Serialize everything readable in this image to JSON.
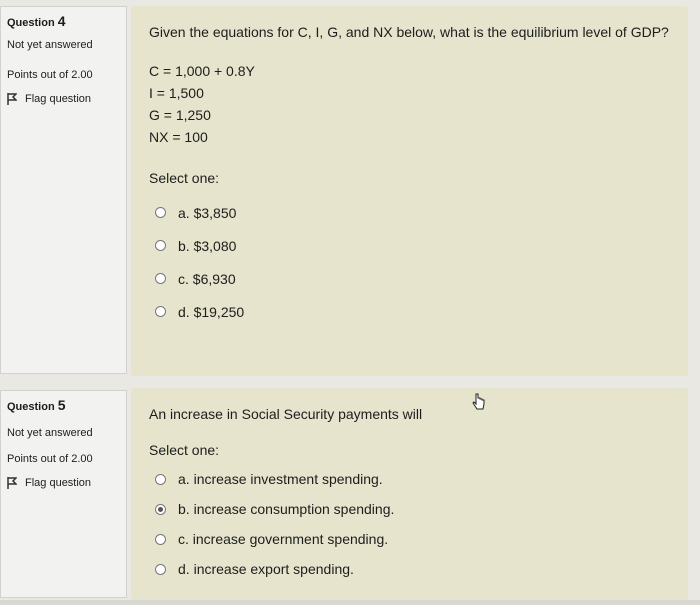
{
  "q4": {
    "info": {
      "label": "Question",
      "number": "4",
      "status": "Not yet answered",
      "points": "Points out of 2.00",
      "flag_label": "Flag question"
    },
    "question_text": "Given the equations for C, I, G, and NX below, what is the equilibrium level of GDP?",
    "equations": [
      "C = 1,000 + 0.8Y",
      "I = 1,500",
      "G = 1,250",
      "NX = 100"
    ],
    "select_label": "Select one:",
    "options": [
      {
        "letter": "a.",
        "text": "$3,850",
        "selected": false
      },
      {
        "letter": "b.",
        "text": "$3,080",
        "selected": false
      },
      {
        "letter": "c.",
        "text": "$6,930",
        "selected": false
      },
      {
        "letter": "d.",
        "text": "$19,250",
        "selected": false
      }
    ]
  },
  "q5": {
    "info": {
      "label": "Question",
      "number": "5",
      "status": "Not yet answered",
      "points": "Points out of 2.00",
      "flag_label": "Flag question"
    },
    "question_text": "An increase in Social Security payments will",
    "select_label": "Select one:",
    "options": [
      {
        "letter": "a.",
        "text": "increase investment spending.",
        "selected": false
      },
      {
        "letter": "b.",
        "text": "increase consumption spending.",
        "selected": true
      },
      {
        "letter": "c.",
        "text": "increase government spending.",
        "selected": false
      },
      {
        "letter": "d.",
        "text": "increase export spending.",
        "selected": false
      }
    ]
  },
  "colors": {
    "page_bg": "#e9e8e3",
    "info_bg": "#f2f2f0",
    "content_bg": "#e6e4cc",
    "text": "#1d1d1d"
  }
}
